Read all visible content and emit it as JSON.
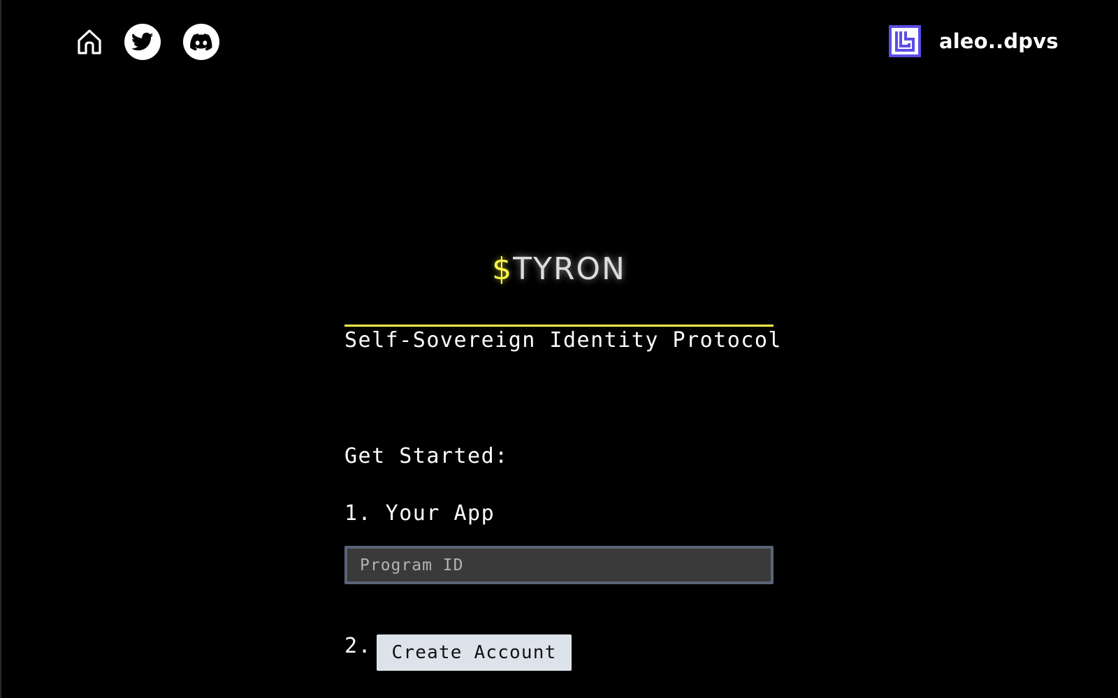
{
  "header": {
    "nav_icons": [
      "home-icon",
      "twitter-icon",
      "discord-icon"
    ],
    "wallet": {
      "icon": "leo-wallet-icon",
      "address": "aleo..dpvs"
    }
  },
  "brand": {
    "symbol": "$",
    "name": "TYRON",
    "tagline": "Self-Sovereign Identity Protocol"
  },
  "get_started": {
    "heading": "Get Started:",
    "step1_label": "1. Your App",
    "program_id_placeholder": "Program ID",
    "program_id_value": "",
    "step2_number": "2.",
    "create_account_label": "Create Account"
  },
  "colors": {
    "background": "#000000",
    "accent_yellow": "#f7f34a",
    "wallet_purple": "#5b4ee6",
    "input_bg": "#3a3a3a",
    "input_border": "#5b6478",
    "button_bg": "#dde3ea"
  }
}
